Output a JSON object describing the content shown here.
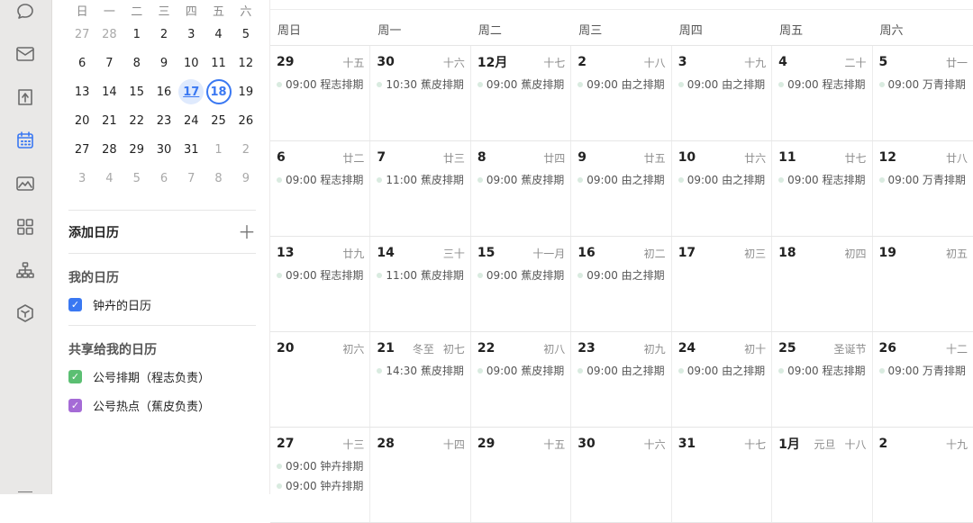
{
  "mini_calendar": {
    "weekdays": [
      "日",
      "一",
      "二",
      "三",
      "四",
      "五",
      "六"
    ],
    "weeks": [
      [
        {
          "d": "27",
          "dim": true
        },
        {
          "d": "28",
          "dim": true
        },
        {
          "d": "1"
        },
        {
          "d": "2"
        },
        {
          "d": "3"
        },
        {
          "d": "4"
        },
        {
          "d": "5"
        }
      ],
      [
        {
          "d": "6"
        },
        {
          "d": "7"
        },
        {
          "d": "8"
        },
        {
          "d": "9"
        },
        {
          "d": "10"
        },
        {
          "d": "11"
        },
        {
          "d": "12"
        }
      ],
      [
        {
          "d": "13"
        },
        {
          "d": "14"
        },
        {
          "d": "15"
        },
        {
          "d": "16"
        },
        {
          "d": "17",
          "today": true
        },
        {
          "d": "18",
          "selected": true
        },
        {
          "d": "19"
        }
      ],
      [
        {
          "d": "20"
        },
        {
          "d": "21"
        },
        {
          "d": "22"
        },
        {
          "d": "23"
        },
        {
          "d": "24"
        },
        {
          "d": "25"
        },
        {
          "d": "26"
        }
      ],
      [
        {
          "d": "27"
        },
        {
          "d": "28"
        },
        {
          "d": "29"
        },
        {
          "d": "30"
        },
        {
          "d": "31"
        },
        {
          "d": "1",
          "dim": true
        },
        {
          "d": "2",
          "dim": true
        }
      ],
      [
        {
          "d": "3",
          "dim": true
        },
        {
          "d": "4",
          "dim": true
        },
        {
          "d": "5",
          "dim": true
        },
        {
          "d": "6",
          "dim": true
        },
        {
          "d": "7",
          "dim": true
        },
        {
          "d": "8",
          "dim": true
        },
        {
          "d": "9",
          "dim": true
        }
      ]
    ]
  },
  "sidebar": {
    "add_calendar": "添加日历",
    "add_icon": "plus-icon",
    "my_calendars_title": "我的日历",
    "my_calendars": [
      {
        "label": "钟卉的日历",
        "color": "#3a78f2",
        "checked": true
      }
    ],
    "shared_title": "共享给我的日历",
    "shared_calendars": [
      {
        "label": "公号排期（程志负责）",
        "color": "#5bbf72",
        "checked": true
      },
      {
        "label": "公号热点（蕉皮负责）",
        "color": "#a56bd6",
        "checked": true
      }
    ]
  },
  "rail_icons": [
    "chat-bubble-icon",
    "mail-icon",
    "docs-icon",
    "calendar-icon",
    "image-icon",
    "apps-grid-icon",
    "org-chart-icon",
    "cube-icon"
  ],
  "month": {
    "weekdays": [
      "周日",
      "周一",
      "周二",
      "周三",
      "周四",
      "周五",
      "周六"
    ],
    "weeks": [
      [
        {
          "num": "29",
          "lunar": "十五",
          "events": [
            "09:00 程志排期"
          ]
        },
        {
          "num": "30",
          "lunar": "十六",
          "events": [
            "10:30 蕉皮排期"
          ]
        },
        {
          "num": "12月",
          "lunar": "十七",
          "events": [
            "09:00 蕉皮排期"
          ]
        },
        {
          "num": "2",
          "lunar": "十八",
          "events": [
            "09:00 由之排期"
          ]
        },
        {
          "num": "3",
          "lunar": "十九",
          "events": [
            "09:00 由之排期"
          ]
        },
        {
          "num": "4",
          "lunar": "二十",
          "events": [
            "09:00 程志排期"
          ]
        },
        {
          "num": "5",
          "lunar": "廿一",
          "events": [
            "09:00 万青排期"
          ]
        }
      ],
      [
        {
          "num": "6",
          "lunar": "廿二",
          "events": [
            "09:00 程志排期"
          ]
        },
        {
          "num": "7",
          "lunar": "廿三",
          "events": [
            "11:00 蕉皮排期"
          ]
        },
        {
          "num": "8",
          "lunar": "廿四",
          "events": [
            "09:00 蕉皮排期"
          ]
        },
        {
          "num": "9",
          "lunar": "廿五",
          "events": [
            "09:00 由之排期"
          ]
        },
        {
          "num": "10",
          "lunar": "廿六",
          "events": [
            "09:00 由之排期"
          ]
        },
        {
          "num": "11",
          "lunar": "廿七",
          "events": [
            "09:00 程志排期"
          ]
        },
        {
          "num": "12",
          "lunar": "廿八",
          "events": [
            "09:00 万青排期"
          ]
        }
      ],
      [
        {
          "num": "13",
          "lunar": "廿九",
          "events": [
            "09:00 程志排期"
          ]
        },
        {
          "num": "14",
          "lunar": "三十",
          "events": [
            "11:00 蕉皮排期"
          ]
        },
        {
          "num": "15",
          "lunar": "十一月",
          "events": [
            "09:00 蕉皮排期"
          ]
        },
        {
          "num": "16",
          "lunar": "初二",
          "events": [
            "09:00 由之排期"
          ]
        },
        {
          "num": "17",
          "lunar": "初三",
          "events": []
        },
        {
          "num": "18",
          "lunar": "初四",
          "events": []
        },
        {
          "num": "19",
          "lunar": "初五",
          "events": []
        }
      ],
      [
        {
          "num": "20",
          "lunar": "初六",
          "events": []
        },
        {
          "num": "21",
          "holiday": "冬至",
          "lunar": "初七",
          "events": [
            "14:30 蕉皮排期"
          ]
        },
        {
          "num": "22",
          "lunar": "初八",
          "events": [
            "09:00 蕉皮排期"
          ]
        },
        {
          "num": "23",
          "lunar": "初九",
          "events": [
            "09:00 由之排期"
          ]
        },
        {
          "num": "24",
          "lunar": "初十",
          "events": [
            "09:00 由之排期"
          ]
        },
        {
          "num": "25",
          "lunar": "圣诞节",
          "events": [
            "09:00 程志排期"
          ]
        },
        {
          "num": "26",
          "lunar": "十二",
          "events": [
            "09:00 万青排期"
          ]
        }
      ],
      [
        {
          "num": "27",
          "lunar": "十三",
          "events": [
            "09:00 钟卉排期",
            "09:00 钟卉排期"
          ]
        },
        {
          "num": "28",
          "lunar": "十四",
          "events": []
        },
        {
          "num": "29",
          "lunar": "十五",
          "events": []
        },
        {
          "num": "30",
          "lunar": "十六",
          "events": []
        },
        {
          "num": "31",
          "lunar": "十七",
          "events": []
        },
        {
          "num": "1月",
          "holiday": "元旦",
          "lunar": "十八",
          "events": []
        },
        {
          "num": "2",
          "lunar": "十九",
          "events": []
        }
      ]
    ]
  }
}
